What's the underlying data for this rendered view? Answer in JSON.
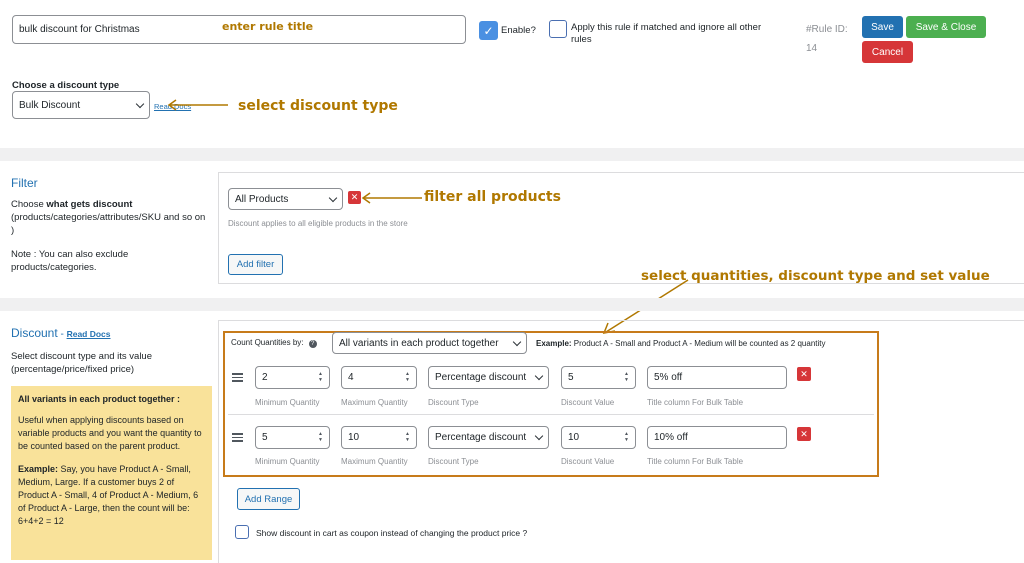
{
  "header": {
    "rule_title_value": "bulk discount for Christmas",
    "enable_label": "Enable?",
    "apply_rule_label": "Apply this rule if matched and ignore all other rules",
    "rule_id_label": "#Rule ID:",
    "rule_id_value": "14",
    "save_label": "Save",
    "save_close_label": "Save & Close",
    "cancel_label": "Cancel"
  },
  "discount_type": {
    "label": "Choose a discount type",
    "selected": "Bulk Discount",
    "read_docs": "Read Docs"
  },
  "filter": {
    "title": "Filter",
    "desc_prefix": "Choose ",
    "desc_bold": "what gets discount",
    "desc_suffix": "(products/categories/attributes/SKU and so on )",
    "note": "Note : You can also exclude products/categories.",
    "selected": "All Products",
    "hint": "Discount applies to all eligible products in the store",
    "add_filter_label": "Add filter"
  },
  "discount": {
    "title": "Discount",
    "read_docs": "Read Docs",
    "desc": "Select discount type and its value (percentage/price/fixed price)",
    "info_title": "All variants in each product together :",
    "info_body": "Useful when applying discounts based on variable products and you want the quantity to be counted based on the parent product.",
    "info_example_label": "Example:",
    "info_example_body": " Say, you have Product A - Small, Medium, Large. If a customer buys 2 of Product A - Small, 4 of Product A - Medium, 6 of Product A - Large, then the count will be: 6+4+2 = 12",
    "count_by_label": "Count Quantities by:",
    "count_by_selected": "All variants in each product together",
    "example_label": "Example:",
    "example_text": " Product A - Small and Product A - Medium will be counted as 2 quantity",
    "column_labels": {
      "min": "Minimum Quantity",
      "max": "Maximum Quantity",
      "type": "Discount Type",
      "value": "Discount Value",
      "title": "Title column For Bulk Table"
    },
    "ranges": [
      {
        "min": "2",
        "max": "4",
        "type": "Percentage discount",
        "value": "5",
        "title": "5% off"
      },
      {
        "min": "5",
        "max": "10",
        "type": "Percentage discount",
        "value": "10",
        "title": "10% off"
      }
    ],
    "add_range_label": "Add Range",
    "coupon_label": "Show discount in cart as coupon instead of changing the product price ?"
  },
  "annotations": {
    "enter_rule_title": "enter rule title",
    "select_discount_type": "select discount type",
    "filter_all_products": "filter all products",
    "select_quantities": "select quantities, discount type and set value"
  },
  "colors": {
    "annotation": "#b07800",
    "primary": "#2271b1",
    "success": "#4caf50",
    "danger": "#d63638"
  }
}
